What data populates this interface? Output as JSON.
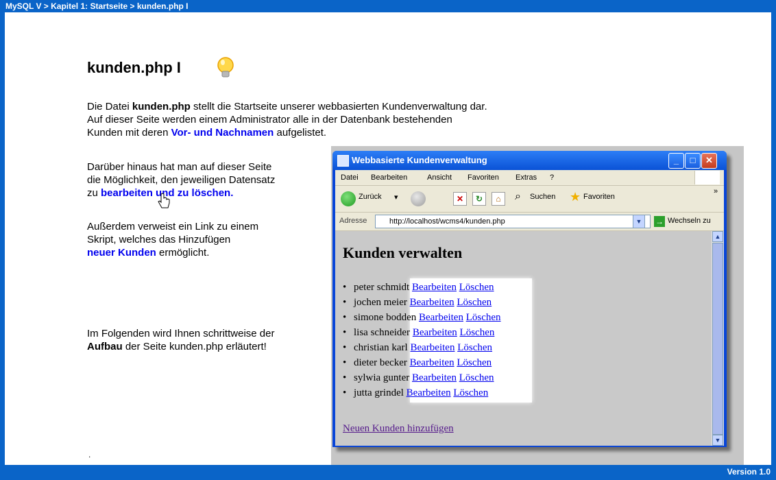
{
  "header": {
    "breadcrumb": "MySQL V > Kapitel 1: Startseite > kunden.php I"
  },
  "page": {
    "title": "kunden.php I",
    "intro": {
      "t1": "Die Datei ",
      "b1": "kunden.php",
      "t2": " stellt die Startseite unserer webbasierten Kundenverwaltung dar.",
      "t3": "Auf dieser Seite werden einem Administrator alle in der Datenbank bestehenden",
      "t4": "Kunden mit deren ",
      "link": "Vor- und Nachnamen",
      "t5": " aufgelistet."
    },
    "p2": {
      "t1": "Darüber hinaus hat man auf dieser Seite",
      "t2": "die Möglichkeit, den jeweiligen Datensatz",
      "t3": "zu ",
      "link": "bearbeiten und zu löschen."
    },
    "p3": {
      "t1": "Außerdem verweist ein Link zu einem",
      "t2": "Skript, welches das Hinzufügen",
      "link": "neuer Kunden",
      "t3": " ermöglicht."
    },
    "p4": {
      "t1": "Im Folgenden wird Ihnen schrittweise der",
      "b1": "Aufbau",
      "t2": " der Seite kunden.php erläutert!"
    },
    "dot": "."
  },
  "browser": {
    "title": "Webbasierte Kundenverwaltung",
    "menu": [
      "Datei",
      "Bearbeiten",
      "Ansicht",
      "Favoriten",
      "Extras",
      "?"
    ],
    "toolbar": {
      "back": "Zurück",
      "search": "Suchen",
      "favorites": "Favoriten",
      "more": "»"
    },
    "address": {
      "label": "Adresse",
      "url": "http://localhost/wcms4/kunden.php",
      "go": "Wechseln zu"
    },
    "heading": "Kunden verwalten",
    "customers": [
      "peter schmidt",
      "jochen meier",
      "simone bodden",
      "lisa schneider",
      "christian karl",
      "dieter becker",
      "sylwia gunter",
      "jutta grindel"
    ],
    "edit_label": "Bearbeiten",
    "delete_label": "Löschen",
    "add_link": "Neuen Kunden hinzufügen"
  },
  "footer": {
    "version": "Version 1.0"
  },
  "colors": {
    "accent": "#0a64c8",
    "link": "#0000ee"
  }
}
